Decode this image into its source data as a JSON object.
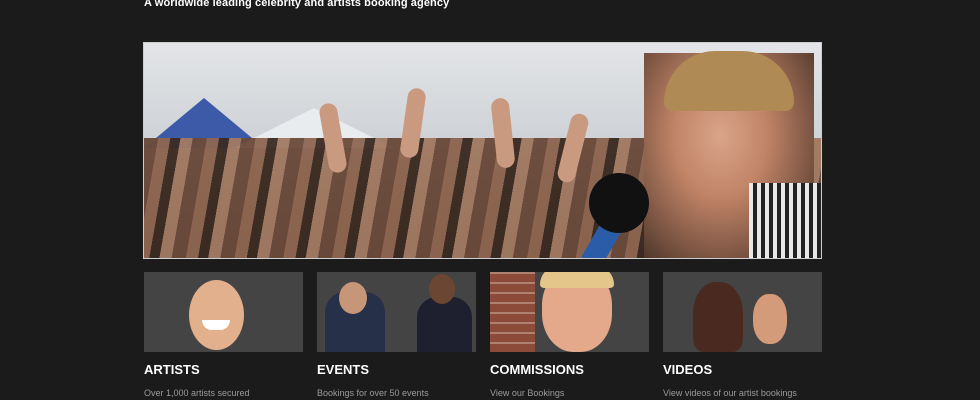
{
  "header": {
    "tagline": "A worldwide leading celebrity and artists booking agency"
  },
  "hero": {
    "alt": "Festival crowd with singer holding microphone"
  },
  "cards": [
    {
      "title": "ARTISTS",
      "desc": "Over 1,000 artists secured"
    },
    {
      "title": "EVENTS",
      "desc": "Bookings for over 50 events"
    },
    {
      "title": "COMMISSIONS",
      "desc": "View our Bookings"
    },
    {
      "title": "VIDEOS",
      "desc": "View videos of our artist bookings"
    }
  ],
  "colors": {
    "background": "#1b1b1b",
    "text": "#ffffff",
    "muted": "#9a9a9a"
  }
}
